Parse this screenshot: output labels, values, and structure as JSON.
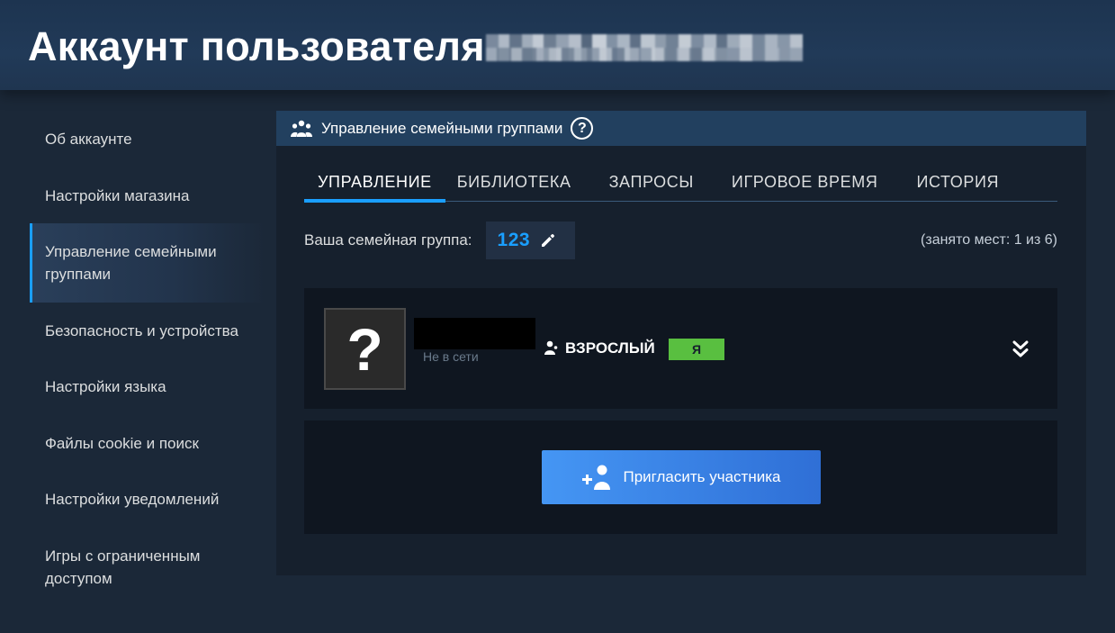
{
  "header": {
    "title": "Аккаунт пользователя"
  },
  "sidebar": {
    "items": [
      {
        "label": "Об аккаунте"
      },
      {
        "label": "Настройки магазина"
      },
      {
        "label": "Управление семейными группами",
        "active": true
      },
      {
        "label": "Безопасность и устройства"
      },
      {
        "label": "Настройки языка"
      },
      {
        "label": "Файлы cookie и поиск"
      },
      {
        "label": "Настройки уведомлений"
      },
      {
        "label": "Игры с ограниченным доступом"
      }
    ]
  },
  "panel": {
    "title": "Управление семейными группами",
    "help_icon": "?",
    "tabs": [
      {
        "label": "УПРАВЛЕНИЕ",
        "active": true
      },
      {
        "label": "БИБЛИОТЕКА"
      },
      {
        "label": "ЗАПРОСЫ"
      },
      {
        "label": "ИГРОВОЕ ВРЕМЯ"
      },
      {
        "label": "ИСТОРИЯ"
      }
    ],
    "group": {
      "label": "Ваша семейная группа:",
      "name": "123",
      "slots": "(занято мест: 1 из 6)"
    },
    "member": {
      "avatar_glyph": "?",
      "status": "Не в сети",
      "role": "ВЗРОСЛЫЙ",
      "badge": "Я"
    },
    "invite": {
      "label": "Пригласить участника"
    }
  },
  "colors": {
    "background": "#1b2838",
    "accent": "#1a9fff",
    "badge": "#59bf40",
    "button": "#3a85e8"
  },
  "icons": [
    "people-icon",
    "help-icon",
    "pencil-icon",
    "person-icon",
    "chevrons-down-icon",
    "add-person-icon"
  ]
}
